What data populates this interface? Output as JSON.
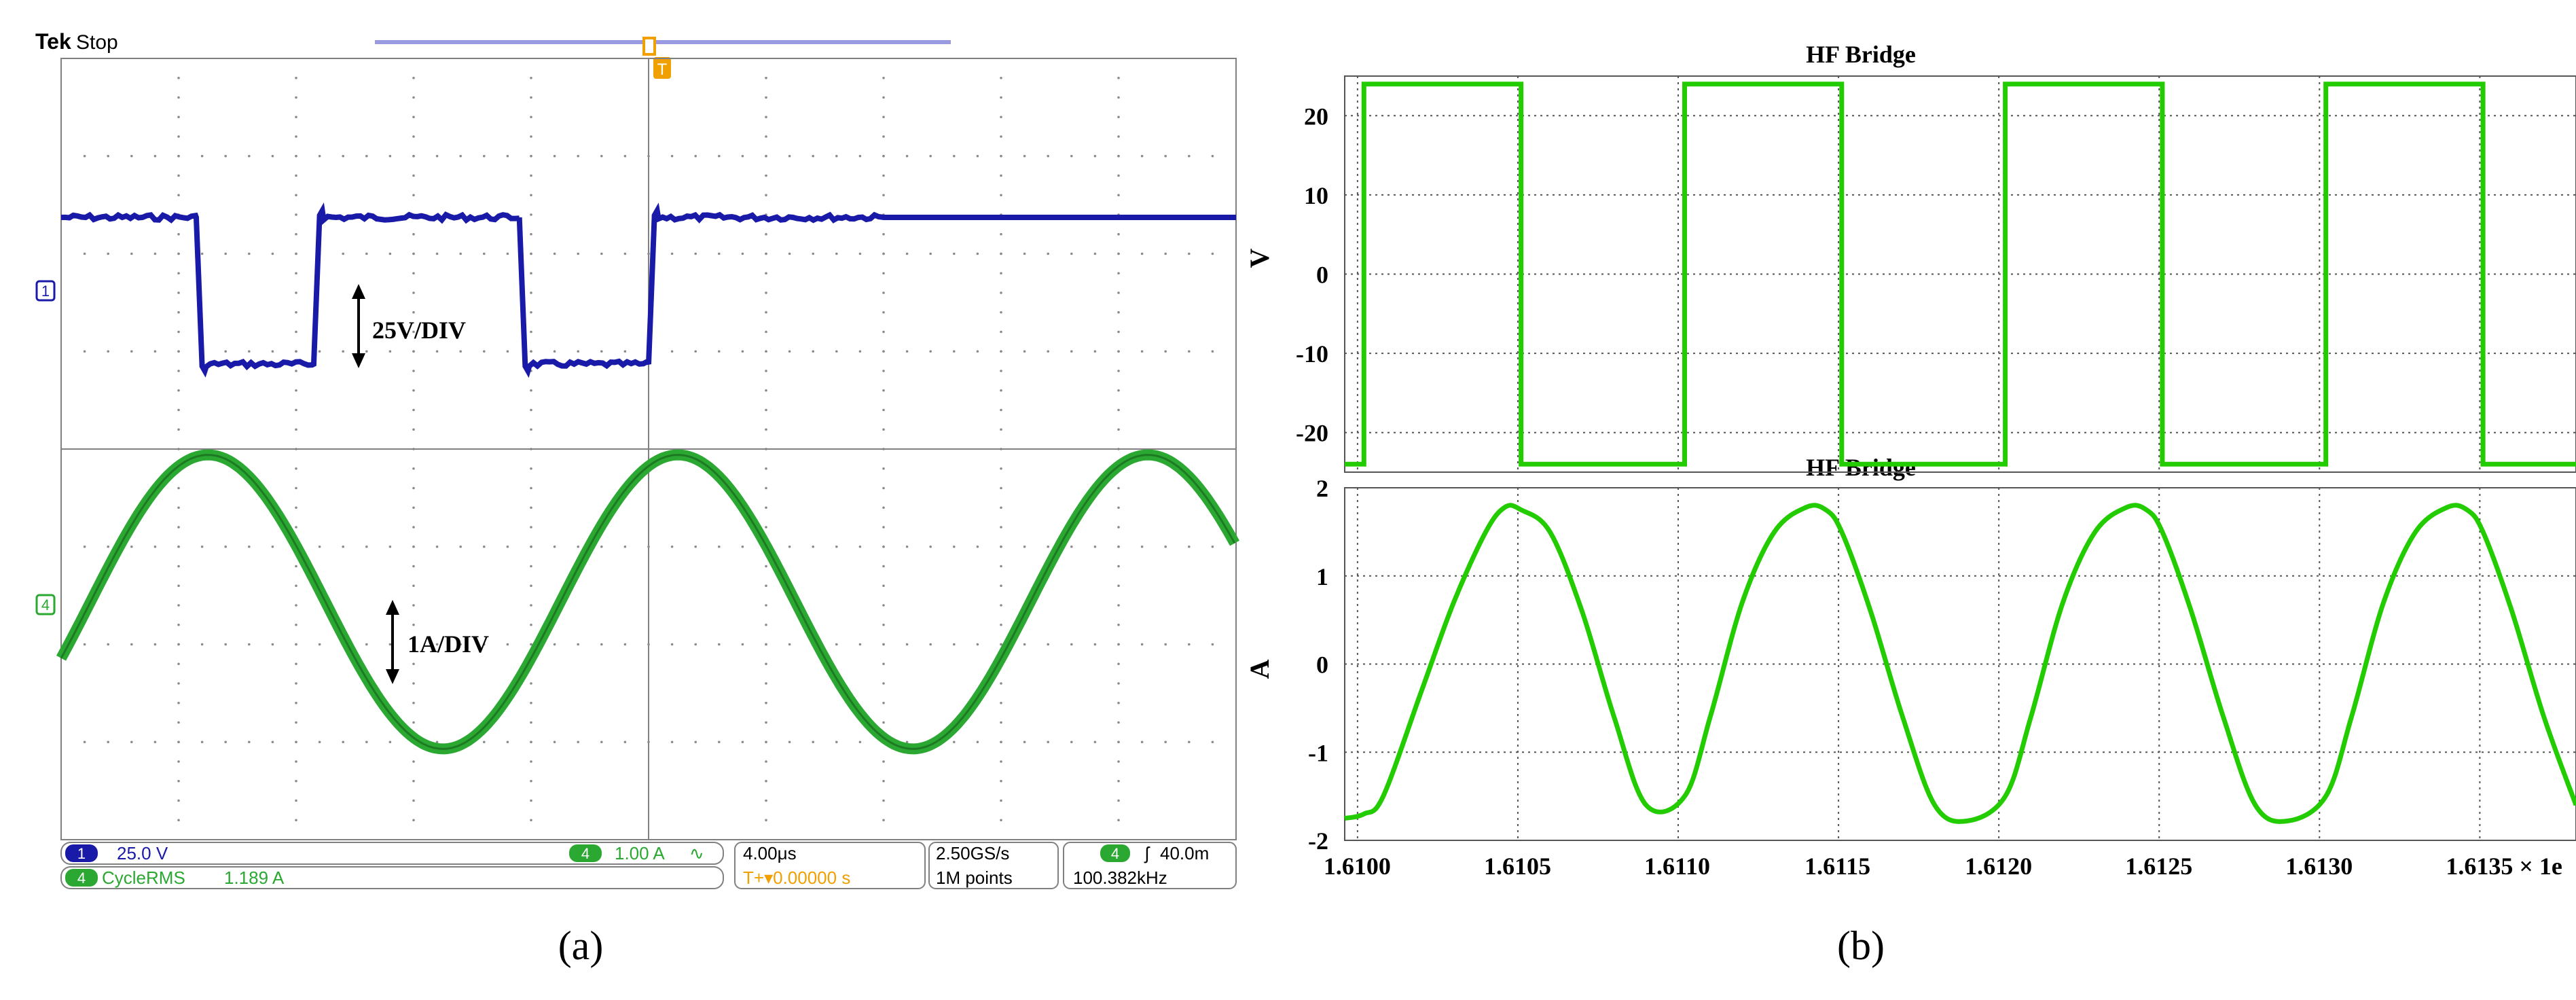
{
  "panel_a": {
    "caption": "(a)",
    "brand": "Tek",
    "run_state": "Stop",
    "trigger_marker": "T",
    "ch1_marker": "1",
    "ch4_marker": "4",
    "annotation_voltage": "25V/DIV",
    "annotation_current": "1A/DIV",
    "readouts": {
      "ch1_label": "1",
      "ch1_scale": "25.0 V",
      "ch4_label": "4",
      "ch4_scale": "1.00 A",
      "ch4_coupling": "∿",
      "meas_label": "4",
      "meas_name": "CycleRMS",
      "meas_value": "1.189 A",
      "timebase": "4.00μs",
      "trigger_pos": "T+▾0.00000 s",
      "sample_rate": "2.50GS/s",
      "record_length": "1M points",
      "trig_src": "4",
      "trig_slope": "ʃ",
      "trig_level": "40.0m",
      "frequency": "100.382kHz"
    },
    "colors": {
      "ch1": "#1a1aa8",
      "ch4": "#2aa832",
      "trigger": "#f0a000",
      "grid": "#808080"
    }
  },
  "panel_b": {
    "caption": "(b)",
    "colors": {
      "trace": "#22cc00",
      "grid": "#555555"
    }
  },
  "chart_data": [
    {
      "type": "line",
      "title": "",
      "series": [
        {
          "name": "",
          "shape": "square",
          "x_div": [
            0,
            1.15,
            1.2,
            2.15,
            2.2,
            3.9,
            3.95,
            5.0,
            5.05,
            7.0
          ],
          "y_div": [
            1,
            1,
            -1,
            -1,
            1,
            1,
            -1,
            -1,
            1,
            1
          ]
        },
        {
          "name": "",
          "shape": "sine",
          "period_div": 4.0,
          "amplitude_div": 1.6
        }
      ],
      "xlim_div": [
        0,
        10
      ],
      "ylim_div": [
        -4,
        4
      ],
      "grid": true
    },
    {
      "type": "line",
      "title": "HF Bridge",
      "xlabel": "",
      "ylabel": "V",
      "x_tick_labels": [],
      "y_ticks": [
        20,
        10,
        0,
        -10,
        -20
      ],
      "ylim": [
        -25,
        25
      ],
      "xlim": [
        1.61,
        1.6138
      ],
      "grid": true,
      "series": [
        {
          "name": "",
          "x": [
            1.60996,
            1.61002,
            1.61002,
            1.61051,
            1.61051,
            1.61102,
            1.61102,
            1.61151,
            1.61151,
            1.61202,
            1.61202,
            1.61251,
            1.61251,
            1.61302,
            1.61302,
            1.61351,
            1.61351,
            1.6138
          ],
          "y": [
            -24,
            -24,
            24,
            24,
            -24,
            -24,
            24,
            24,
            -24,
            -24,
            24,
            24,
            -24,
            -24,
            24,
            24,
            -24,
            -24
          ]
        }
      ]
    },
    {
      "type": "line",
      "title": "HF Bridge",
      "xlabel": "",
      "ylabel": "A",
      "x_ticks": [
        1.61,
        1.6105,
        1.611,
        1.6115,
        1.612,
        1.6125,
        1.613,
        1.6135
      ],
      "x_tick_labels": [
        "1.6100",
        "1.6105",
        "1.6110",
        "1.6115",
        "1.6120",
        "1.6125",
        "1.6130",
        "1.6135 × 1e"
      ],
      "y_ticks": [
        2,
        1,
        0,
        -1,
        -2
      ],
      "ylim": [
        -2,
        2
      ],
      "xlim": [
        1.60996,
        1.6138
      ],
      "grid": true,
      "series": [
        {
          "name": "",
          "x": [
            1.60996,
            1.61002,
            1.61008,
            1.6102,
            1.6103,
            1.6104,
            1.61046,
            1.61051,
            1.6106,
            1.6107,
            1.6108,
            1.6109,
            1.61102,
            1.6111,
            1.6112,
            1.6113,
            1.6114,
            1.61146,
            1.61151,
            1.6116,
            1.6117,
            1.6118,
            1.6119,
            1.61202,
            1.6121,
            1.6122,
            1.6123,
            1.6124,
            1.61246,
            1.61251,
            1.6126,
            1.6127,
            1.6128,
            1.6129,
            1.61302,
            1.6131,
            1.6132,
            1.6133,
            1.6134,
            1.61346,
            1.61351,
            1.6136,
            1.6137,
            1.6138
          ],
          "y": [
            -1.75,
            -1.7,
            -1.5,
            -0.3,
            0.7,
            1.5,
            1.78,
            1.75,
            1.5,
            0.6,
            -0.6,
            -1.6,
            -1.5,
            -0.6,
            0.7,
            1.5,
            1.78,
            1.75,
            1.5,
            0.6,
            -0.6,
            -1.6,
            -1.78,
            -1.5,
            -0.6,
            0.7,
            1.5,
            1.78,
            1.75,
            1.5,
            0.6,
            -0.6,
            -1.6,
            -1.78,
            -1.5,
            -0.6,
            0.7,
            1.5,
            1.78,
            1.75,
            1.5,
            0.6,
            -0.6,
            -1.6
          ]
        }
      ]
    }
  ]
}
